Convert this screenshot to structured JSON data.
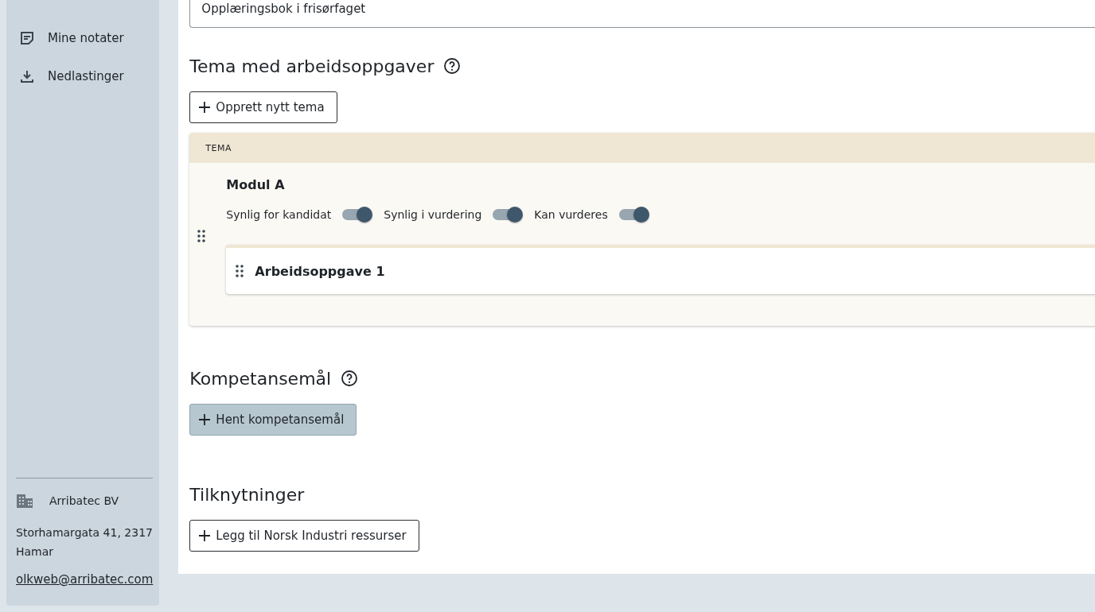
{
  "sidebar": {
    "items": [
      {
        "label": "Mine notater",
        "kind": "notes"
      },
      {
        "label": "Nedlastinger",
        "kind": "download"
      }
    ],
    "company": {
      "name": "Arribatec BV",
      "address": "Storhamargata 41, 2317 Hamar",
      "email": "olkweb@arribatec.com"
    }
  },
  "main": {
    "title_field": {
      "value": "Opplæringsbok i frisørfaget"
    },
    "themes_section": {
      "heading": "Tema med arbeidsoppgaver",
      "add_button": "Opprett nytt tema",
      "table": {
        "header": "TEMA",
        "themes": [
          {
            "name": "Modul A",
            "toggles": [
              {
                "label": "Synlig for kandidat",
                "on": true
              },
              {
                "label": "Synlig i vurdering",
                "on": true
              },
              {
                "label": "Kan vurderes",
                "on": true
              }
            ],
            "tasks": [
              "Arbeidsoppgave 1"
            ]
          }
        ]
      }
    },
    "competence_section": {
      "heading": "Kompetansemål",
      "fetch_button": "Hent kompetansemål"
    },
    "links_section": {
      "heading": "Tilknytninger",
      "add_button": "Legg til Norsk Industri ressurser"
    }
  }
}
